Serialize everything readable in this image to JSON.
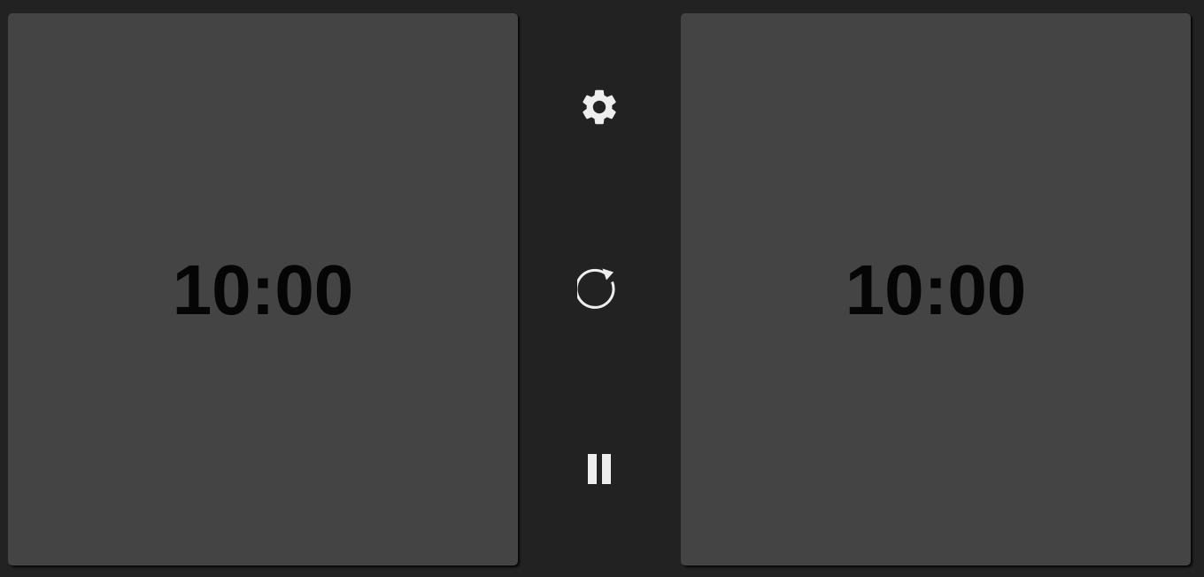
{
  "clocks": {
    "left": {
      "time": "10:00"
    },
    "right": {
      "time": "10:00"
    }
  },
  "controls": {
    "settings": {
      "icon": "gear-icon"
    },
    "reset": {
      "icon": "reset-icon"
    },
    "pause": {
      "icon": "pause-icon"
    }
  },
  "colors": {
    "background": "#222222",
    "panel": "#444444",
    "time_text": "#050505",
    "icon": "#eeeeee"
  }
}
